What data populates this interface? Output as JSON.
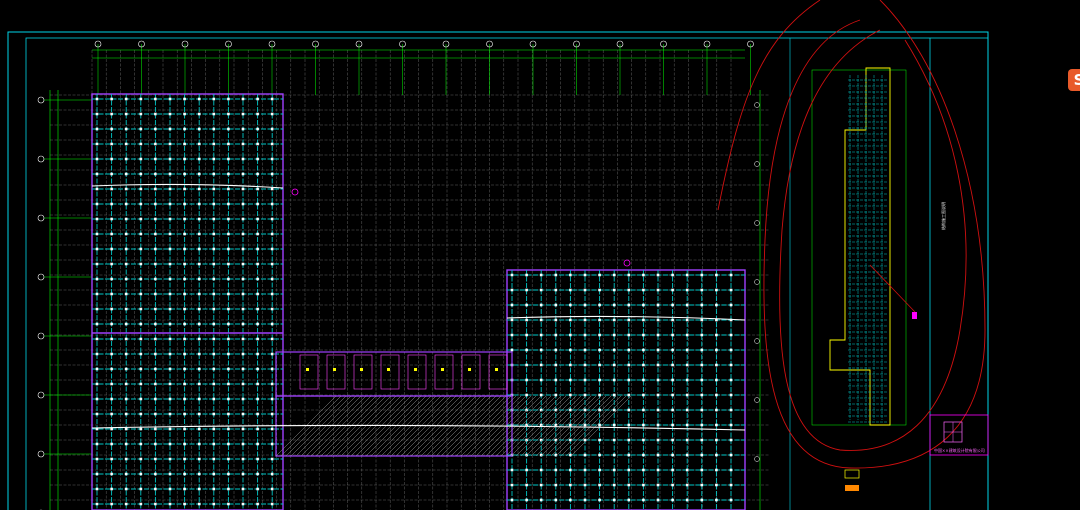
{
  "app": {
    "view": "cad-drawing-canvas"
  },
  "colors": {
    "background": "#000000",
    "frame": "#00d5e8",
    "axis": "#00ff00",
    "grid": "#8a8a8a",
    "column": "#00c8c8",
    "wall": "#a040ff",
    "beam": "#ffffff",
    "markup": "#d01010",
    "magenta": "#ff00ff",
    "yellow": "#ffff00"
  },
  "overlay": {
    "badge_glyph": "S",
    "badge_color": "#e85a2a"
  },
  "title_block": {
    "company_text": "中国××建筑设计院有限公司",
    "vertical_note": "结构施工图说明"
  },
  "icons": {
    "logo": "logo-badge-icon",
    "title_stamp": "title-stamp-icon"
  }
}
